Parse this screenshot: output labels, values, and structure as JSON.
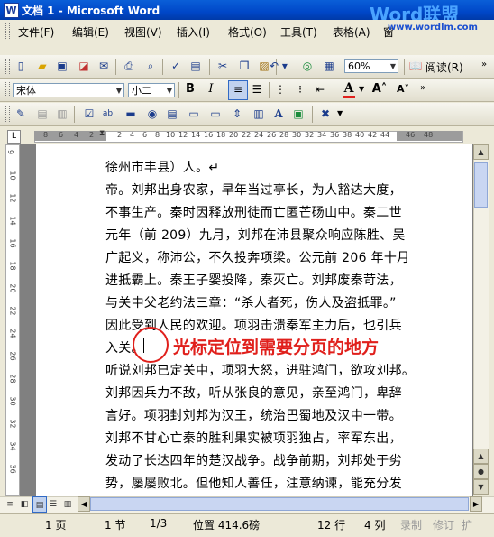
{
  "window": {
    "title": "文档 1 - Microsoft Word",
    "brand": "Word联盟",
    "brand_url": "www.wordlm.com"
  },
  "menu": {
    "items": [
      "文件(F)",
      "编辑(E)",
      "视图(V)",
      "插入(I)",
      "格式(O)",
      "工具(T)",
      "表格(A)",
      "窗"
    ]
  },
  "toolbar": {
    "zoom": "60%",
    "read_label": "阅读(R)"
  },
  "format": {
    "font": "宋体",
    "size": "小二",
    "bold": "B",
    "italic": "I",
    "font_color_letter": "A"
  },
  "ruler": {
    "numbers": [
      "8",
      "6",
      "4",
      "2",
      "2",
      "4",
      "6",
      "8",
      "10",
      "12",
      "14",
      "16",
      "18",
      "20",
      "22",
      "24",
      "26",
      "28",
      "30",
      "32",
      "34",
      "36",
      "38",
      "40",
      "42",
      "44",
      "46",
      "48"
    ],
    "vnumbers": [
      "9",
      "10",
      "12",
      "14",
      "16",
      "18",
      "20",
      "22",
      "24",
      "26",
      "28",
      "30",
      "32",
      "34",
      "36"
    ]
  },
  "document": {
    "lines": [
      "徐州市丰县）人。↵",
      "帝。刘邦出身农家，早年当过亭长，为人豁达大度，",
      "不事生产。秦时因释放刑徒而亡匿芒砀山中。秦二世",
      "元年（前 209）九月，刘邦在沛县聚众响应陈胜、吴",
      "广起义，称沛公，不久投奔项梁。公元前 206 年十月",
      "进抵霸上。秦王子婴投降，秦灭亡。刘邦废秦苛法，",
      "与关中父老约法三章：“杀人者死，伤人及盗抵罪。”",
      "因此受到人民的欢迎。项羽击溃秦军主力后，也引兵",
      "入关。",
      "听说刘邦已定关中，项羽大怒，进驻鸿门，欲攻刘邦。",
      "刘邦因兵力不敌，听从张良的意见，亲至鸿门，卑辞",
      "言好。项羽封刘邦为汉王，统治巴蜀地及汉中一带。",
      "刘邦不甘心亡秦的胜利果实被项羽独占，率军东出，",
      "发动了长达四年的楚汉战争。战争前期，刘邦处于劣",
      "势，屡屡败北。但他知人善任，注意纳谏，能充分发"
    ],
    "annotation": "光标定位到需要分页的地方"
  },
  "status": {
    "page": "1 页",
    "section": "1 节",
    "pages": "1/3",
    "position": "位置 414.6磅",
    "row": "12 行",
    "col": "4 列",
    "rec": "录制",
    "trk": "修订",
    "ext": "扩"
  },
  "colors": {
    "title_bar": "#0a5fd8",
    "annotation": "#e0201c",
    "font_color_bar": "#e0201c"
  }
}
